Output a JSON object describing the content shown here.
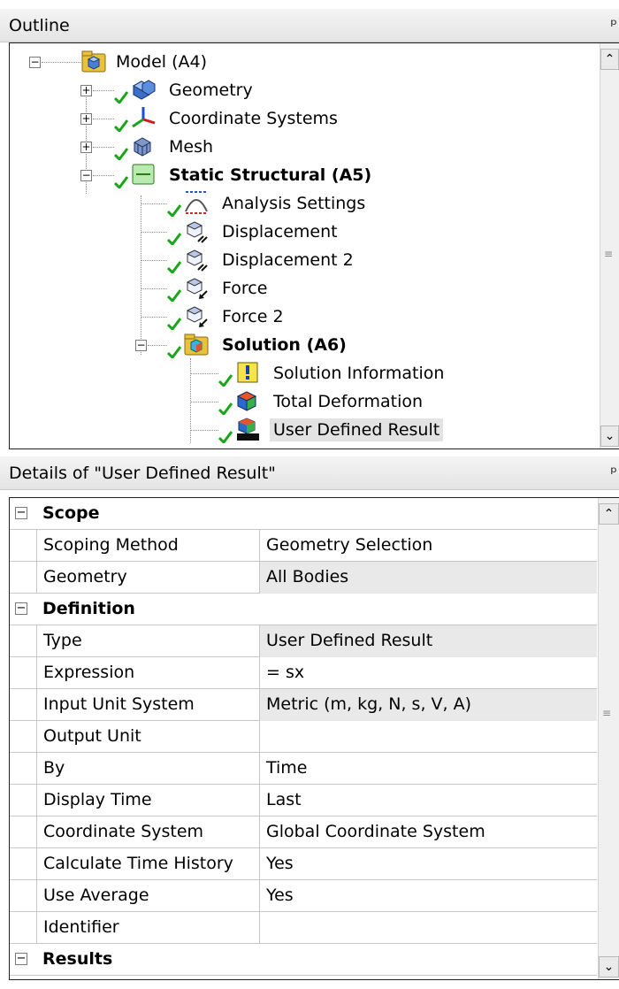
{
  "outline": {
    "title": "Outline",
    "pin_glyph": "Ṟ",
    "nodes": [
      {
        "label": "Model (A4)",
        "bold": true,
        "expander": "−",
        "icon": "model-icon"
      },
      {
        "label": "Geometry",
        "bold": false,
        "expander": "+",
        "icon": "geometry-icon"
      },
      {
        "label": "Coordinate Systems",
        "bold": false,
        "expander": "+",
        "icon": "coordinate-systems-icon"
      },
      {
        "label": "Mesh",
        "bold": false,
        "expander": "+",
        "icon": "mesh-icon"
      },
      {
        "label": "Static Structural (A5)",
        "bold": true,
        "expander": "−",
        "icon": "static-structural-icon"
      },
      {
        "label": "Analysis Settings",
        "bold": false,
        "icon": "analysis-settings-icon"
      },
      {
        "label": "Displacement",
        "bold": false,
        "icon": "displacement-icon"
      },
      {
        "label": "Displacement 2",
        "bold": false,
        "icon": "displacement-icon"
      },
      {
        "label": "Force",
        "bold": false,
        "icon": "force-icon"
      },
      {
        "label": "Force 2",
        "bold": false,
        "icon": "force-icon"
      },
      {
        "label": "Solution (A6)",
        "bold": true,
        "expander": "−",
        "icon": "solution-icon"
      },
      {
        "label": "Solution Information",
        "bold": false,
        "icon": "solution-information-icon"
      },
      {
        "label": "Total Deformation",
        "bold": false,
        "icon": "total-deformation-icon"
      },
      {
        "label": "User Defined Result",
        "bold": false,
        "selected": true,
        "icon": "user-defined-result-icon"
      }
    ]
  },
  "details": {
    "title": "Details of \"User Defined Result\"",
    "scope_category": "Scope",
    "scoping_method_key": "Scoping Method",
    "scoping_method_value": "Geometry Selection",
    "geometry_key": "Geometry",
    "geometry_value": "All Bodies",
    "definition_category": "Definition",
    "type_key": "Type",
    "type_value": "User Defined Result",
    "expression_key": "Expression",
    "expression_value": "= sx",
    "input_unit_key": "Input Unit System",
    "input_unit_value": "Metric (m, kg, N, s, V, A)",
    "output_unit_key": "Output Unit",
    "output_unit_value": "",
    "by_key": "By",
    "by_value": "Time",
    "display_time_key": "Display Time",
    "display_time_value": "Last",
    "coord_sys_key": "Coordinate System",
    "coord_sys_value": "Global Coordinate System",
    "calc_hist_key": "Calculate Time History",
    "calc_hist_value": "Yes",
    "use_avg_key": "Use Average",
    "use_avg_value": "Yes",
    "identifier_key": "Identifier",
    "identifier_value": "",
    "results_category": "Results",
    "collapse_glyph": "−"
  },
  "colors": {
    "check_green": "#1aa51a",
    "header_bg": "#ececec",
    "readonly_cell": "#e9e9e9",
    "selection": "#e3e3e3"
  }
}
